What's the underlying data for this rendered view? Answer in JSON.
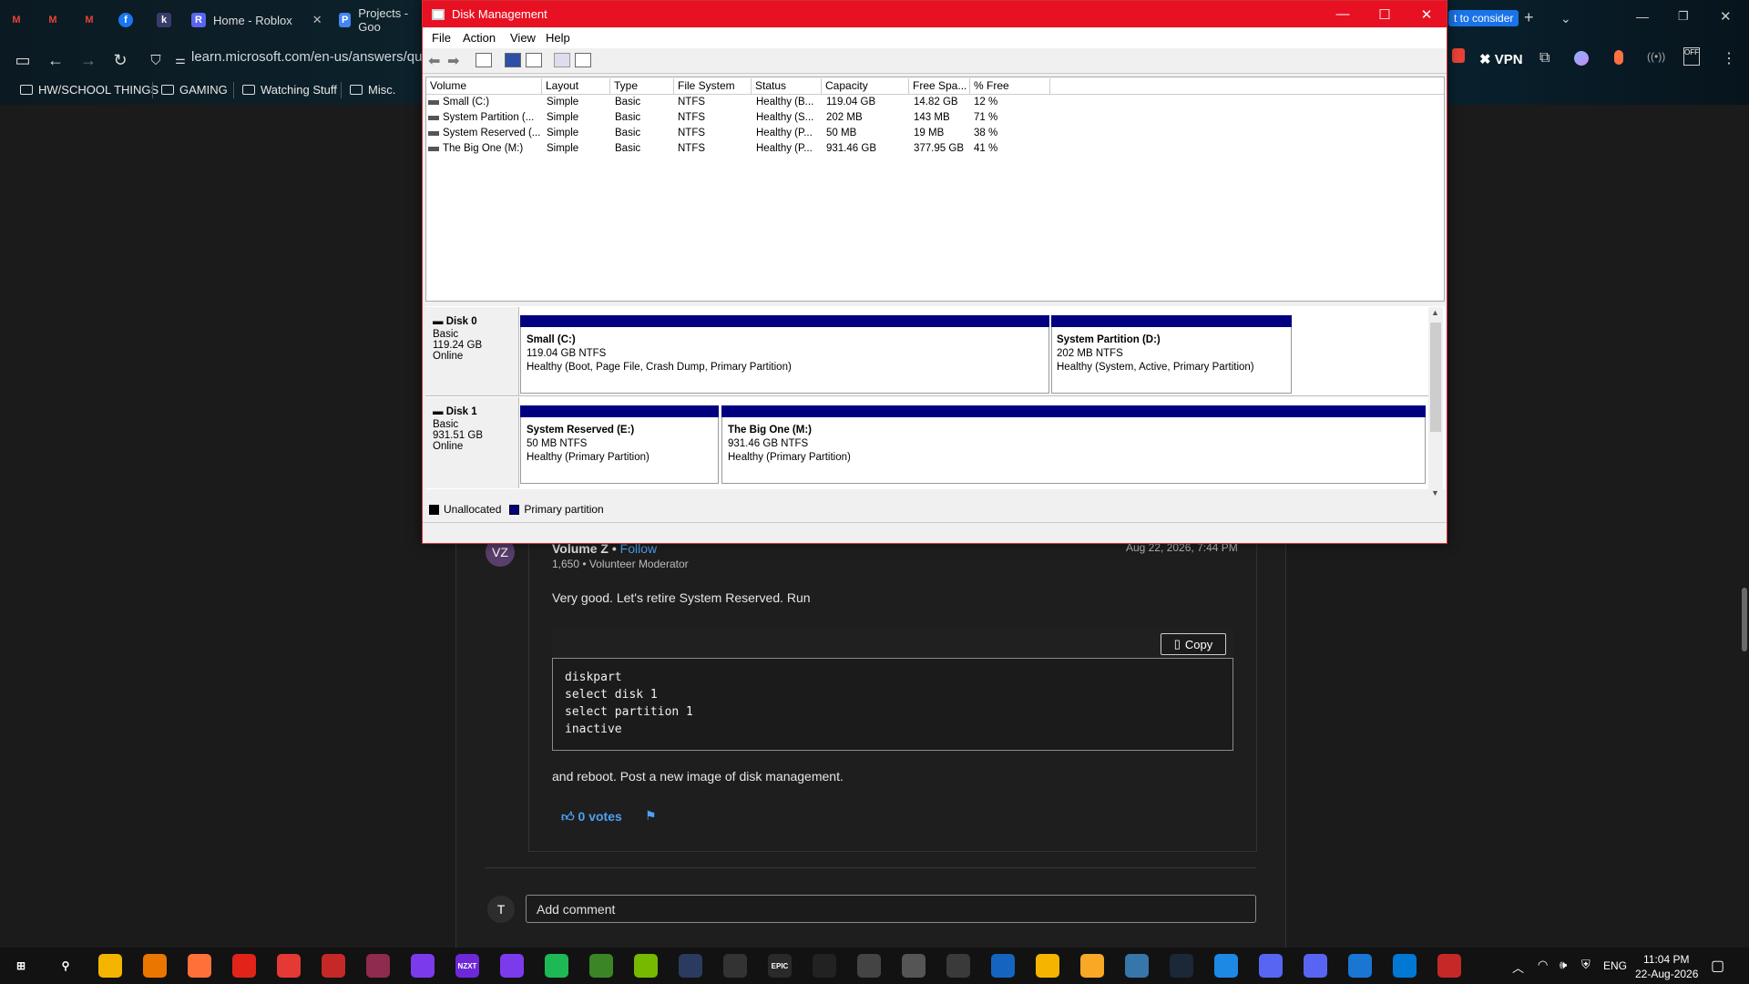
{
  "browser": {
    "tabs": [
      {
        "icon": "M",
        "label": ""
      },
      {
        "icon": "M",
        "label": ""
      },
      {
        "icon": "M",
        "label": ""
      },
      {
        "icon": "f",
        "label": ""
      },
      {
        "icon": "k",
        "label": ""
      },
      {
        "icon": "R",
        "label": "Home - Roblox"
      },
      {
        "icon": "P",
        "label": "Projects - Goo"
      }
    ],
    "tab_right_label": "t to consider",
    "url": "learn.microsoft.com/en-us/answers/que",
    "vpn_label": "VPN",
    "bookmarks": [
      "HW/SCHOOL THINGS",
      "GAMING",
      "Watching Stuff",
      "Misc."
    ]
  },
  "post": {
    "avatar": "VZ",
    "author": "Volume Z",
    "follow": "Follow",
    "meta": "1,650 • Volunteer Moderator",
    "date": "Aug 22, 2026, 7:44 PM",
    "body1": "Very good. Let's retire System Reserved. Run",
    "copy_label": "Copy",
    "code": [
      "diskpart",
      "select disk 1",
      "select partition 1",
      "inactive"
    ],
    "body2": "and reboot. Post a new image of disk management.",
    "votes": "0 votes",
    "comment_avatar": "T",
    "comment_placeholder": "Add comment"
  },
  "disk_management": {
    "title": "Disk Management",
    "menu": [
      "File",
      "Action",
      "View",
      "Help"
    ],
    "columns": [
      "Volume",
      "Layout",
      "Type",
      "File System",
      "Status",
      "Capacity",
      "Free Spa...",
      "% Free"
    ],
    "volumes": [
      [
        "Small (C:)",
        "Simple",
        "Basic",
        "NTFS",
        "Healthy (B...",
        "119.04 GB",
        "14.82 GB",
        "12 %"
      ],
      [
        "System Partition (...",
        "Simple",
        "Basic",
        "NTFS",
        "Healthy (S...",
        "202 MB",
        "143 MB",
        "71 %"
      ],
      [
        "System Reserved (...",
        "Simple",
        "Basic",
        "NTFS",
        "Healthy (P...",
        "50 MB",
        "19 MB",
        "38 %"
      ],
      [
        "The Big One (M:)",
        "Simple",
        "Basic",
        "NTFS",
        "Healthy (P...",
        "931.46 GB",
        "377.95 GB",
        "41 %"
      ]
    ],
    "disks": [
      {
        "name": "Disk 0",
        "type": "Basic",
        "size": "119.24 GB",
        "state": "Online",
        "partitions": [
          {
            "title": "Small  (C:)",
            "size": "119.04 GB NTFS",
            "status": "Healthy (Boot, Page File, Crash Dump, Primary Partition)"
          },
          {
            "title": "System Partition  (D:)",
            "size": "202 MB NTFS",
            "status": "Healthy (System, Active, Primary Partition)"
          }
        ]
      },
      {
        "name": "Disk 1",
        "type": "Basic",
        "size": "931.51 GB",
        "state": "Online",
        "partitions": [
          {
            "title": "System Reserved  (E:)",
            "size": "50 MB NTFS",
            "status": "Healthy (Primary Partition)"
          },
          {
            "title": "The Big One  (M:)",
            "size": "931.46 GB NTFS",
            "status": "Healthy (Primary Partition)"
          }
        ]
      }
    ],
    "legend": [
      "Unallocated",
      "Primary partition"
    ],
    "colors": {
      "primary_partition": "#000080",
      "unallocated": "#000000",
      "titlebar": "#e81123"
    }
  },
  "taskbar": {
    "icons": [
      "start-icon",
      "search-icon",
      "file-explorer-icon",
      "blender-icon",
      "firefox-icon",
      "roblox-icon",
      "launcher-icon",
      "game-icon",
      "vegas-icon",
      "heart-app-icon",
      "nzxt-icon",
      "podcast-icon",
      "spotify-icon",
      "minecraft-icon",
      "nvidia-icon",
      "resolve-icon",
      "terminal-icon",
      "epic-games-icon",
      "capcut-icon",
      "obs-icon",
      "apps-icon",
      "unity-icon",
      "notepad-icon",
      "folder-icon",
      "maps-icon",
      "python-icon",
      "steam-icon",
      "pulse-icon",
      "roblox-studio-icon",
      "discord-icon",
      "remote-icon",
      "paint-icon",
      "app-icon"
    ],
    "nzxt_label": "NZXT",
    "epic_label": "EPIC",
    "language": "ENG",
    "time": "11:04 PM",
    "date": "22-Aug-2026"
  }
}
